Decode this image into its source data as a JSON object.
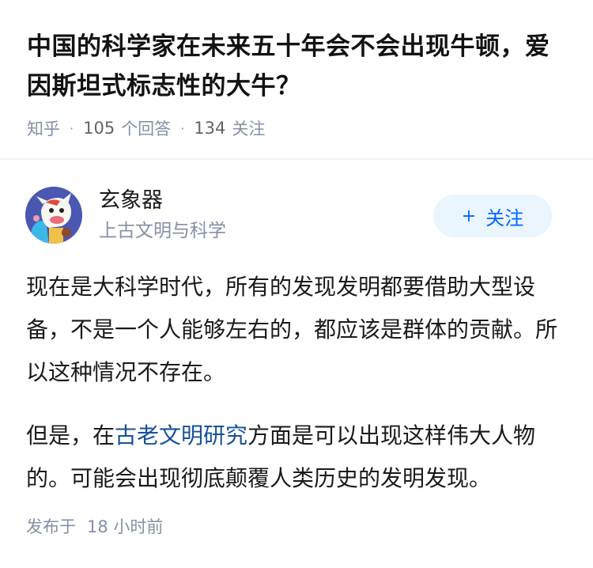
{
  "question": {
    "title": "中国的科学家在未来五十年会不会出现牛顿，爱因斯坦式标志性的大牛？",
    "source": "知乎",
    "answers_count": "105",
    "answers_label": "个回答",
    "followers_count": "134",
    "followers_label": "关注"
  },
  "author": {
    "name": "玄象器",
    "bio": "上古文明与科学",
    "avatar_icon": "cartoon-cow-avatar-icon",
    "follow_label": "关注",
    "follow_icon": "plus-icon"
  },
  "answer": {
    "para1": "现在是大科学时代，所有的发现发明都要借助大型设备，不是一个人能够左右的，都应该是群体的贡献。所以这种情况不存在。",
    "para2_before": "但是，在",
    "para2_link": "古老文明研究",
    "para2_after": "方面是可以出现这样伟大人物的。可能会出现彻底颠覆人类历史的发明发现。"
  },
  "footer": {
    "published_label": "发布于",
    "published_time": "18 小时前"
  },
  "colors": {
    "accent": "#0066ff",
    "link": "#175199",
    "meta": "#8590a6",
    "follow_bg": "#ebf5fd"
  }
}
